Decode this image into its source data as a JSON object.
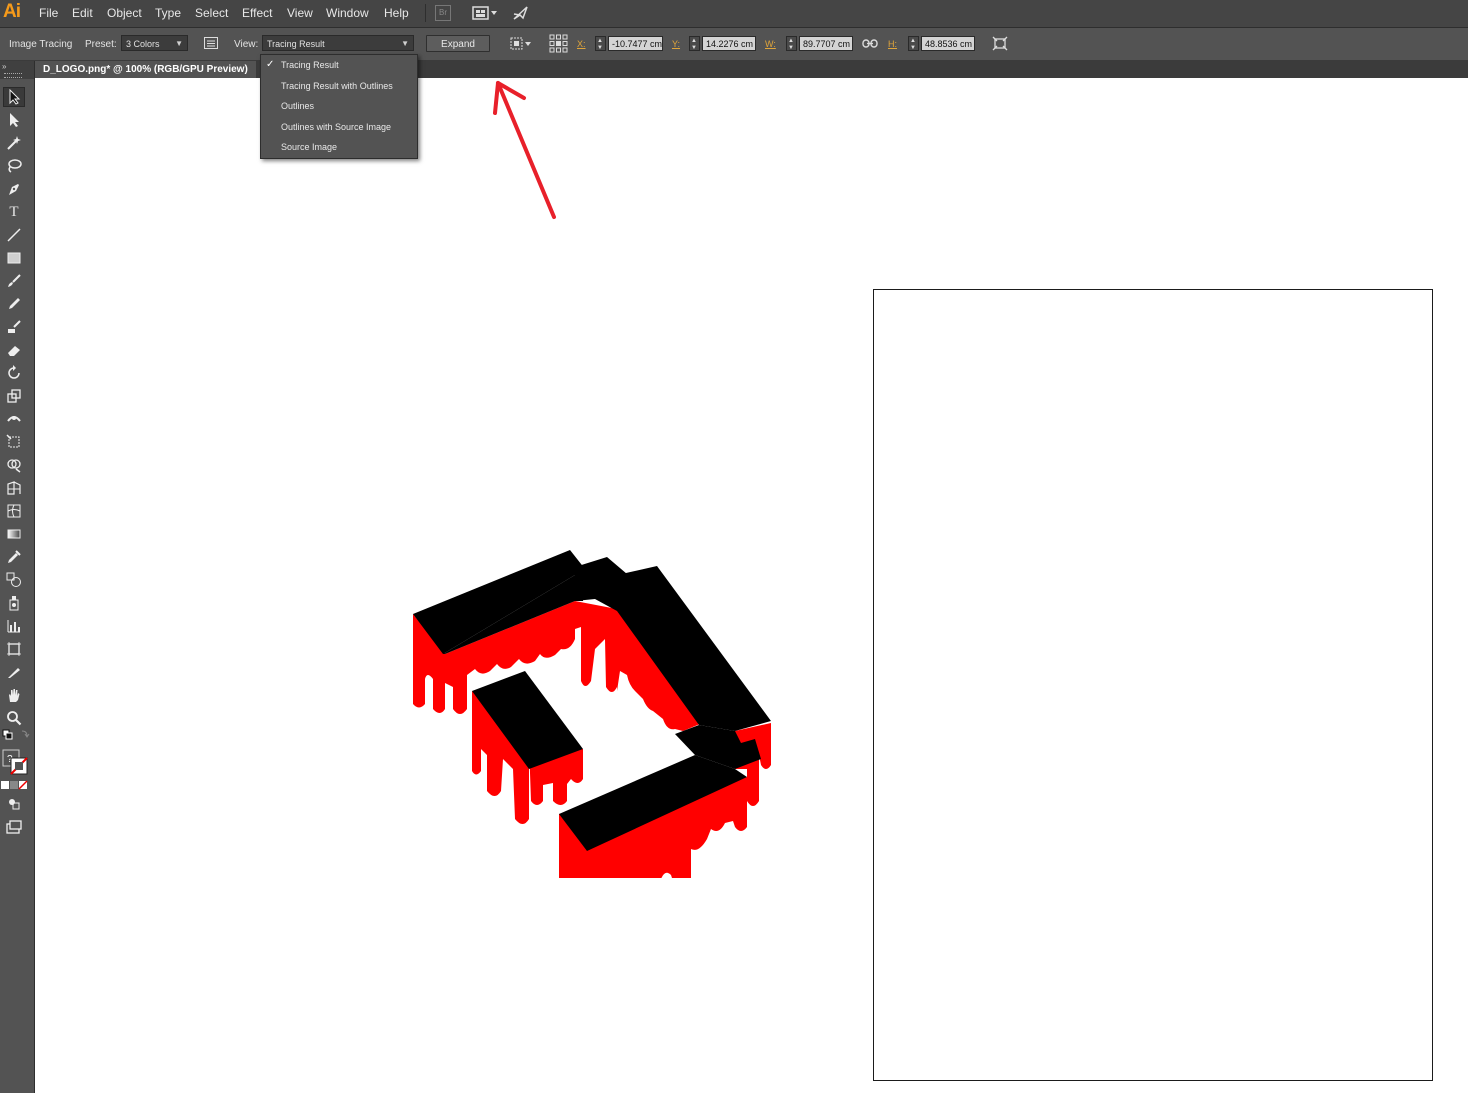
{
  "app": {
    "logo": "Ai"
  },
  "menubar": {
    "items": [
      "File",
      "Edit",
      "Object",
      "Type",
      "Select",
      "Effect",
      "View",
      "Window",
      "Help"
    ],
    "bridge_label": "Br"
  },
  "controlbar": {
    "panel_name": "Image Tracing",
    "preset_label": "Preset:",
    "preset_value": "3 Colors",
    "view_label": "View:",
    "view_value": "Tracing Result",
    "expand_label": "Expand",
    "x_label": "X:",
    "x_value": "-10.7477 cm",
    "y_label": "Y:",
    "y_value": "14.2276 cm",
    "w_label": "W:",
    "w_value": "89.7707 cm",
    "h_label": "H:",
    "h_value": "48.8536 cm"
  },
  "document": {
    "tab_title": "D_LOGO.png* @ 100% (RGB/GPU Preview)"
  },
  "view_dropdown": {
    "selected_index": 0,
    "options": [
      "Tracing Result",
      "Tracing Result with Outlines",
      "Outlines",
      "Outlines with Source Image",
      "Source Image"
    ]
  },
  "colors": {
    "logo_red": "#ff0000",
    "logo_black": "#000000",
    "annotation_arrow": "#e8202a",
    "ai_orange": "#f59a1b"
  },
  "tools": [
    "selection-tool",
    "direct-selection-tool",
    "magic-wand-tool",
    "lasso-tool",
    "pen-tool",
    "type-tool",
    "line-tool",
    "rectangle-tool",
    "paintbrush-tool",
    "pencil-tool",
    "blob-brush-tool",
    "eraser-tool",
    "rotate-tool",
    "scale-tool",
    "width-tool",
    "free-transform-tool",
    "shape-builder-tool",
    "perspective-grid-tool",
    "mesh-tool",
    "gradient-tool",
    "eyedropper-tool",
    "blend-tool",
    "symbol-sprayer-tool",
    "column-graph-tool",
    "artboard-tool",
    "slice-tool",
    "hand-tool",
    "zoom-tool"
  ]
}
